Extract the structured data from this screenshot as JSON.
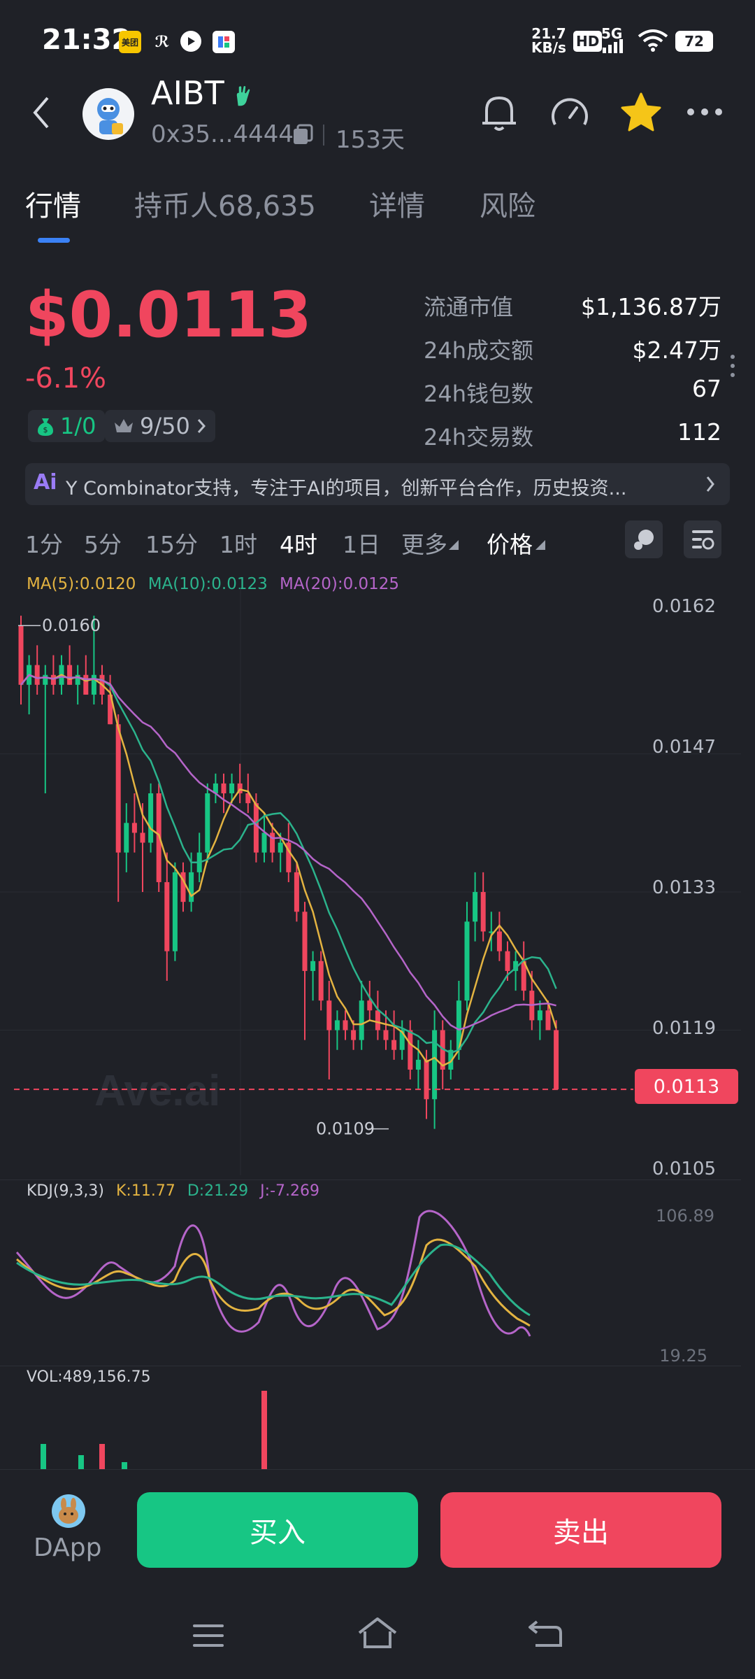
{
  "status_bar": {
    "time": "21:32",
    "net_speed_value": "21.7",
    "net_speed_unit": "KB/s",
    "hd": "HD",
    "signal": "5G",
    "battery": "72",
    "app_icon_1_text": "美团"
  },
  "header": {
    "token_name": "AIBT",
    "address": "0x35...4444",
    "age": "153天",
    "icons": [
      "back-arrow-icon",
      "bell-icon",
      "speedometer-icon",
      "star-icon",
      "more-icon"
    ]
  },
  "tabs": [
    "行情",
    "持币人68,635",
    "详情",
    "风险"
  ],
  "active_tab": "行情",
  "price": {
    "value": "$0.0113",
    "change": "-6.1%",
    "badge1": "1/0",
    "badge2": "9/50"
  },
  "stats": [
    {
      "label": "流通市值",
      "value": "$1,136.87万"
    },
    {
      "label": "24h成交额",
      "value": "$2.47万"
    },
    {
      "label": "24h钱包数",
      "value": "67"
    },
    {
      "label": "24h交易数",
      "value": "112"
    }
  ],
  "banner": {
    "prefix": "Ai",
    "text": "Y Combinator支持，专注于AI的项目，创新平台合作，历史投资..."
  },
  "timeframes": [
    "1分",
    "5分",
    "15分",
    "1时",
    "4时",
    "1日",
    "更多",
    "价格"
  ],
  "active_timeframe": "4时",
  "ma_legend": {
    "ma5": "MA(5):0.0120",
    "ma10": "MA(10):0.0123",
    "ma20": "MA(20):0.0125"
  },
  "kdj_legend": {
    "name": "KDJ(9,3,3)",
    "k": "K:11.77",
    "d": "D:21.29",
    "j": "J:-7.269"
  },
  "vol_legend": "VOL:489,156.75",
  "watermark": "Ave.ai",
  "colors": {
    "up": "#17c684",
    "down": "#f0465e",
    "ma5": "#e3b341",
    "ma10": "#2bb38c",
    "ma20": "#b565c9"
  },
  "chart_data": {
    "type": "candlestick",
    "y_axis_ticks": [
      "0.0162",
      "0.0147",
      "0.0133",
      "0.0119",
      "0.0105"
    ],
    "ylim": [
      0.0105,
      0.0162
    ],
    "current_price_label": "0.0113",
    "current_price": 0.0113,
    "high_label": "0.0160",
    "high_value": 0.016,
    "low_label": "0.0109",
    "low_value": 0.0109,
    "candles": [
      [
        0.016,
        0.0161,
        0.0152,
        0.0154
      ],
      [
        0.0154,
        0.0157,
        0.0151,
        0.0156
      ],
      [
        0.0156,
        0.0158,
        0.0153,
        0.0154
      ],
      [
        0.0154,
        0.0156,
        0.0143,
        0.0155
      ],
      [
        0.0155,
        0.0157,
        0.0153,
        0.0154
      ],
      [
        0.0154,
        0.0157,
        0.0153,
        0.0156
      ],
      [
        0.0156,
        0.0158,
        0.0154,
        0.0154
      ],
      [
        0.0154,
        0.0156,
        0.0152,
        0.0155
      ],
      [
        0.0155,
        0.0157,
        0.0153,
        0.0153
      ],
      [
        0.0153,
        0.0161,
        0.0152,
        0.0155
      ],
      [
        0.0155,
        0.0156,
        0.0152,
        0.0153
      ],
      [
        0.0153,
        0.0155,
        0.015,
        0.015
      ],
      [
        0.015,
        0.0151,
        0.0132,
        0.0137
      ],
      [
        0.0137,
        0.0142,
        0.0135,
        0.014
      ],
      [
        0.014,
        0.0143,
        0.0137,
        0.0139
      ],
      [
        0.0139,
        0.0142,
        0.0133,
        0.0138
      ],
      [
        0.0138,
        0.0144,
        0.0137,
        0.0143
      ],
      [
        0.0143,
        0.0144,
        0.0133,
        0.0134
      ],
      [
        0.0134,
        0.0137,
        0.0124,
        0.0127
      ],
      [
        0.0127,
        0.0136,
        0.0126,
        0.0135
      ],
      [
        0.0135,
        0.0136,
        0.0131,
        0.0132
      ],
      [
        0.0132,
        0.0137,
        0.0131,
        0.0135
      ],
      [
        0.0135,
        0.0139,
        0.0134,
        0.0137
      ],
      [
        0.0137,
        0.0144,
        0.0136,
        0.0143
      ],
      [
        0.0143,
        0.0145,
        0.0142,
        0.0144
      ],
      [
        0.0144,
        0.0145,
        0.0141,
        0.0143
      ],
      [
        0.0143,
        0.0145,
        0.0142,
        0.0144
      ],
      [
        0.0144,
        0.0146,
        0.0142,
        0.0143
      ],
      [
        0.0143,
        0.0145,
        0.0141,
        0.0142
      ],
      [
        0.0142,
        0.0143,
        0.0136,
        0.0137
      ],
      [
        0.0137,
        0.0141,
        0.0136,
        0.0139
      ],
      [
        0.0139,
        0.014,
        0.0136,
        0.0137
      ],
      [
        0.0137,
        0.0139,
        0.0135,
        0.0138
      ],
      [
        0.0138,
        0.014,
        0.0134,
        0.0135
      ],
      [
        0.0135,
        0.0136,
        0.013,
        0.0131
      ],
      [
        0.0131,
        0.0132,
        0.0118,
        0.0125
      ],
      [
        0.0125,
        0.0127,
        0.0122,
        0.0126
      ],
      [
        0.0126,
        0.0127,
        0.0121,
        0.0122
      ],
      [
        0.0122,
        0.0124,
        0.0114,
        0.0119
      ],
      [
        0.0119,
        0.0121,
        0.0117,
        0.012
      ],
      [
        0.012,
        0.0121,
        0.0118,
        0.0119
      ],
      [
        0.0119,
        0.012,
        0.0117,
        0.0118
      ],
      [
        0.0118,
        0.0124,
        0.0117,
        0.0122
      ],
      [
        0.0122,
        0.0124,
        0.012,
        0.0121
      ],
      [
        0.0121,
        0.0123,
        0.0118,
        0.0119
      ],
      [
        0.0119,
        0.0121,
        0.0117,
        0.0118
      ],
      [
        0.0118,
        0.0121,
        0.0116,
        0.0117
      ],
      [
        0.0117,
        0.012,
        0.0116,
        0.0119
      ],
      [
        0.0119,
        0.012,
        0.0114,
        0.0115
      ],
      [
        0.0115,
        0.0118,
        0.0113,
        0.0116
      ],
      [
        0.0116,
        0.0117,
        0.011,
        0.0112
      ],
      [
        0.0112,
        0.0121,
        0.0109,
        0.0119
      ],
      [
        0.0119,
        0.012,
        0.0113,
        0.0115
      ],
      [
        0.0115,
        0.0118,
        0.0114,
        0.0117
      ],
      [
        0.0117,
        0.0124,
        0.0116,
        0.0122
      ],
      [
        0.0122,
        0.0132,
        0.0121,
        0.013
      ],
      [
        0.013,
        0.0135,
        0.0128,
        0.0133
      ],
      [
        0.0133,
        0.0135,
        0.0128,
        0.0129
      ],
      [
        0.0129,
        0.0131,
        0.0127,
        0.0129
      ],
      [
        0.0129,
        0.0131,
        0.0126,
        0.0127
      ],
      [
        0.0127,
        0.0128,
        0.0124,
        0.0125
      ],
      [
        0.0125,
        0.0127,
        0.0123,
        0.0126
      ],
      [
        0.0126,
        0.0128,
        0.0122,
        0.0123
      ],
      [
        0.0123,
        0.0125,
        0.0119,
        0.012
      ],
      [
        0.012,
        0.0122,
        0.0118,
        0.0121
      ],
      [
        0.0121,
        0.0122,
        0.0119,
        0.0119
      ],
      [
        0.0119,
        0.012,
        0.0113,
        0.0113
      ]
    ]
  },
  "kdj_axis": {
    "max_label": "106.89",
    "min_label": "19.25"
  },
  "actions": {
    "dapp_label": "DApp",
    "buy": "买入",
    "sell": "卖出"
  }
}
